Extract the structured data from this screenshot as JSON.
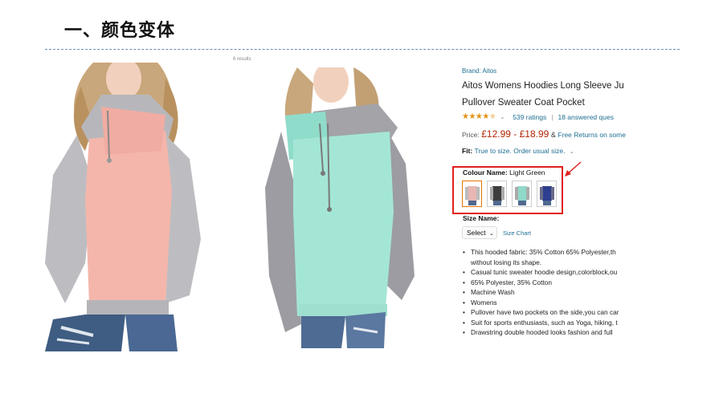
{
  "slide": {
    "title": "一、颜色变体",
    "tiny_caption": "6 results"
  },
  "product": {
    "brand": "Brand: Aitos",
    "title_line1": "Aitos Womens Hoodies Long Sleeve Ju",
    "title_line2": "Pullover Sweater Coat Pocket",
    "stars": "★★★★",
    "ratings": "539 ratings",
    "separator": "|",
    "answered": "18 answered ques",
    "price_label": "Price:",
    "price": "£12.99 - £18.99",
    "price_amp": "&",
    "price_note": "Free Returns on some",
    "fit_label": "Fit:",
    "fit_value": "True to size. Order usual size.",
    "colour_label": "Colour Name:",
    "colour_value": "Light Green",
    "swatches": [
      {
        "name": "pink-grey",
        "color": "#e8b7b3"
      },
      {
        "name": "black-grey",
        "color": "#3d3d3d"
      },
      {
        "name": "light-green",
        "color": "#8fd9c9"
      },
      {
        "name": "navy-blue",
        "color": "#2e3f8f"
      }
    ],
    "size_label": "Size Name:",
    "size_select": "Select",
    "size_chart": "Size Chart",
    "bullets": [
      "This hooded fabric: 35% Cotton 65% Polyester,th",
      "without losing its shape.",
      "Casual tunic sweater hoodie design,colorblock,ou",
      "65% Polyester, 35% Cotton",
      "Machine Wash",
      "Womens",
      "Pullover have two pockets on the side,you can car",
      "Suit for sports enthusiasts, such as Yoga, hiking, t",
      "Drawstring double hooded looks fashion and full"
    ]
  },
  "colors": {
    "link": "#1f6e92",
    "price": "#b12704",
    "star": "#e4910f",
    "highlight_box": "#e02020",
    "divider": "#6c8fb0"
  }
}
